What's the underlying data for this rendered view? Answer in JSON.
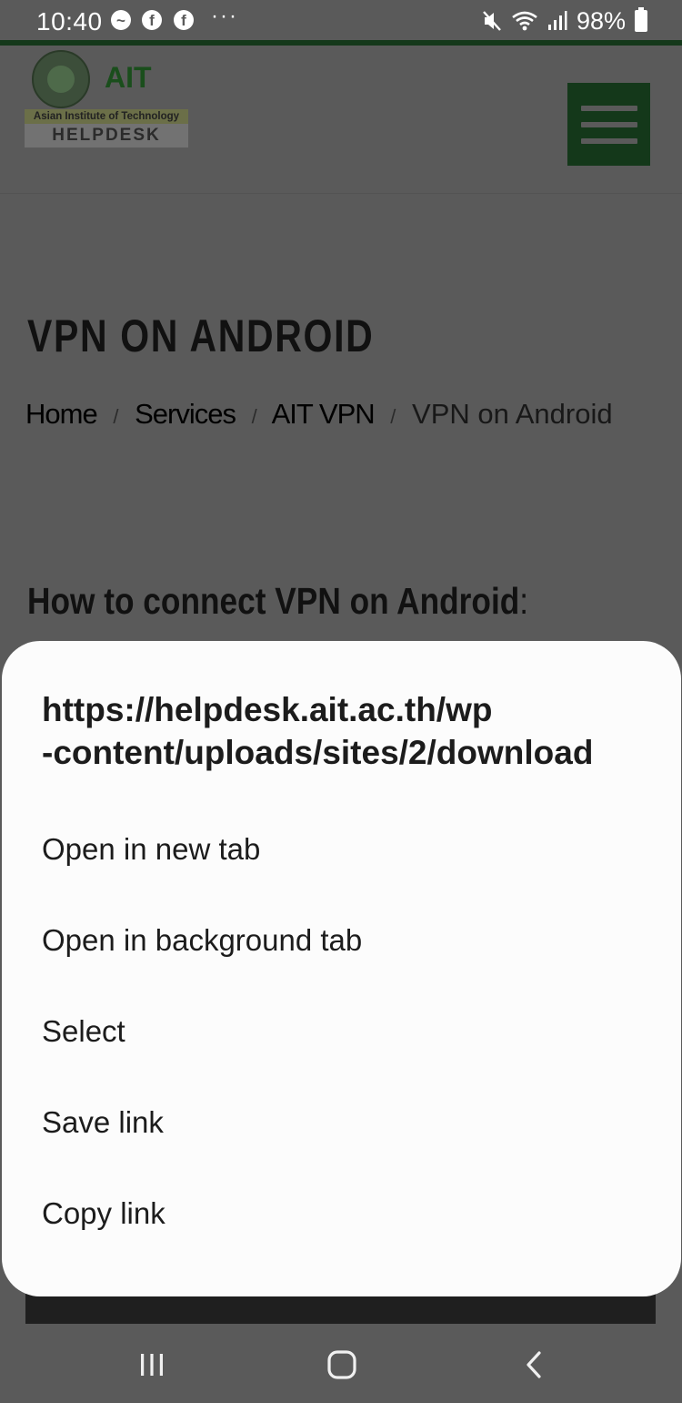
{
  "status_bar": {
    "time": "10:40",
    "notification_icons": [
      "messenger-icon",
      "facebook-icon",
      "facebook-icon"
    ],
    "notif_glyphs": {
      "messenger": "~",
      "facebook": "f"
    },
    "more_label": "···",
    "right_icons": [
      "mute-icon",
      "wifi-icon",
      "signal-icon",
      "battery-icon"
    ],
    "battery_percent": "98%"
  },
  "header": {
    "logo": {
      "title": "AIT",
      "subtitle": "Asian Institute of Technology",
      "helpdesk": "HELPDESK"
    },
    "menu_icon": "hamburger-icon"
  },
  "page": {
    "title": "VPN ON ANDROID",
    "breadcrumb": {
      "separator": "/",
      "items": [
        "Home",
        "Services",
        "AIT VPN"
      ],
      "current": "VPN on Android"
    },
    "section_heading": "How to connect VPN on Android",
    "section_heading_suffix": ":"
  },
  "context_menu": {
    "url_line1": "https://helpdesk.ait.ac.th/wp",
    "url_line2": "-content/uploads/sites/2/download",
    "items": [
      "Open in new tab",
      "Open in background tab",
      "Select",
      "Save link",
      "Copy link"
    ]
  },
  "nav_bar": {
    "icons": [
      "recents-icon",
      "home-icon",
      "back-icon"
    ]
  },
  "colors": {
    "brand_green": "#14381a",
    "scrim": "#5a5a5a",
    "sheet_background": "#fcfcfc",
    "text_dark": "#1c1c1c"
  }
}
